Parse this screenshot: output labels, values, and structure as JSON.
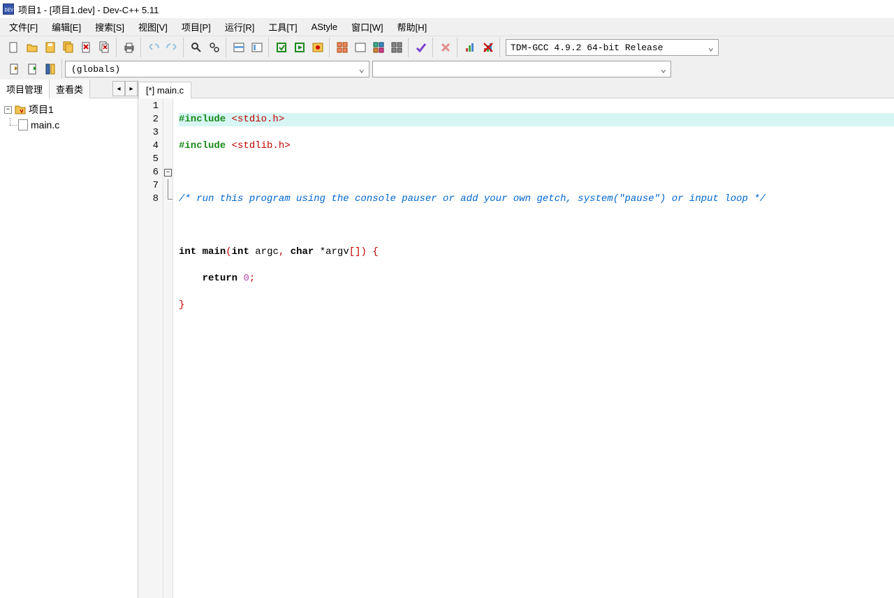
{
  "window": {
    "title": "项目1 - [项目1.dev] - Dev-C++ 5.11"
  },
  "menu": {
    "file": "文件[F]",
    "edit": "编辑[E]",
    "search": "搜索[S]",
    "view": "视图[V]",
    "project": "项目[P]",
    "run": "运行[R]",
    "tools": "工具[T]",
    "astyle": "AStyle",
    "window": "窗口[W]",
    "help": "帮助[H]"
  },
  "toolbar": {
    "compiler_preset": "TDM-GCC 4.9.2 64-bit Release"
  },
  "combos": {
    "globals": "(globals)",
    "scope": ""
  },
  "sidebar": {
    "tab_project": "项目管理",
    "tab_classes": "查看类",
    "project_name": "项目1",
    "file_name": "main.c",
    "expander_symbol": "−"
  },
  "editor": {
    "tab_label": "[*] main.c",
    "lines": {
      "l1": "1",
      "l2": "2",
      "l3": "3",
      "l4": "4",
      "l5": "5",
      "l6": "6",
      "l7": "7",
      "l8": "8"
    },
    "code": {
      "include1_kw": "#include ",
      "include1_arg": "<stdio.h>",
      "include2_kw": "#include ",
      "include2_arg": "<stdlib.h>",
      "comment": "/* run this program using the console pauser or add your own getch, system(\"pause\") or input loop */",
      "fn_int": "int",
      "fn_main": " main",
      "fn_open": "(",
      "fn_arg_int": "int",
      "fn_argc": " argc",
      "fn_comma": ", ",
      "fn_char": "char",
      "fn_star": " *",
      "fn_argv": "argv",
      "fn_brk": "[]",
      "fn_close": ") ",
      "fn_brace_open": "{",
      "ret_indent": "    ",
      "ret_kw": "return",
      "ret_sp": " ",
      "ret_val": "0",
      "ret_semi": ";",
      "fn_brace_close": "}"
    },
    "fold_minus": "−"
  }
}
